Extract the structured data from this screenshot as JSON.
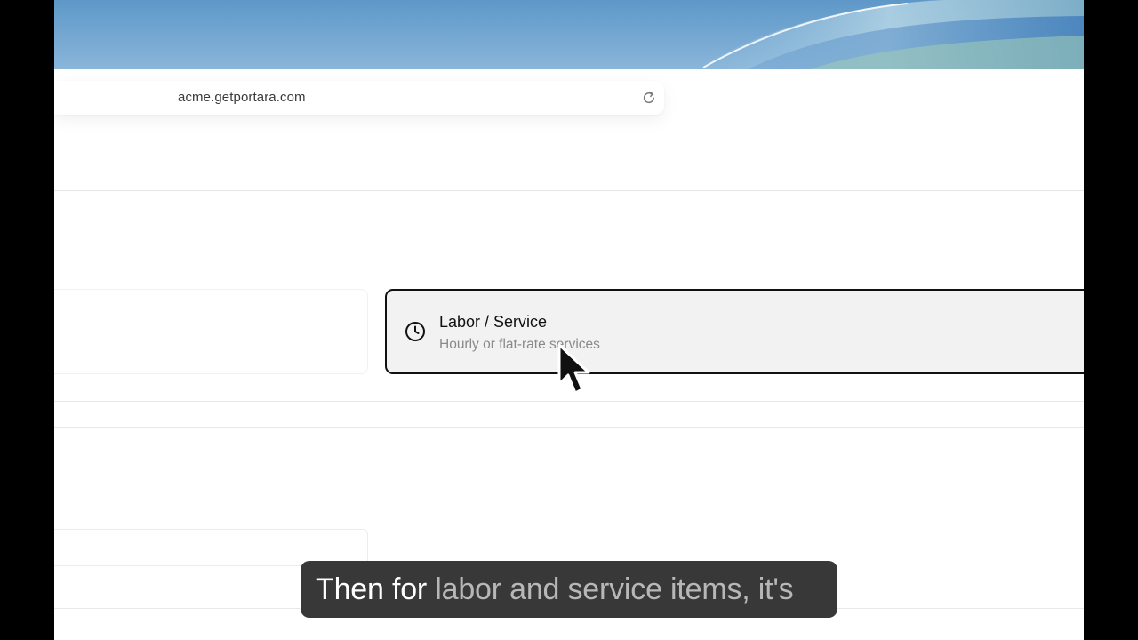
{
  "browser": {
    "url": "acme.getportara.com",
    "reload_icon": "reload-icon"
  },
  "item_types": {
    "selected_option": {
      "title": "Labor / Service",
      "subtitle": "Hourly or flat-rate services",
      "icon": "clock-icon"
    }
  },
  "caption": {
    "spoken": "Then for ",
    "upcoming": "labor and service items, it's"
  },
  "colors": {
    "selected_border": "#111111",
    "selected_background": "#f2f2f2",
    "caption_background": "#303030"
  }
}
